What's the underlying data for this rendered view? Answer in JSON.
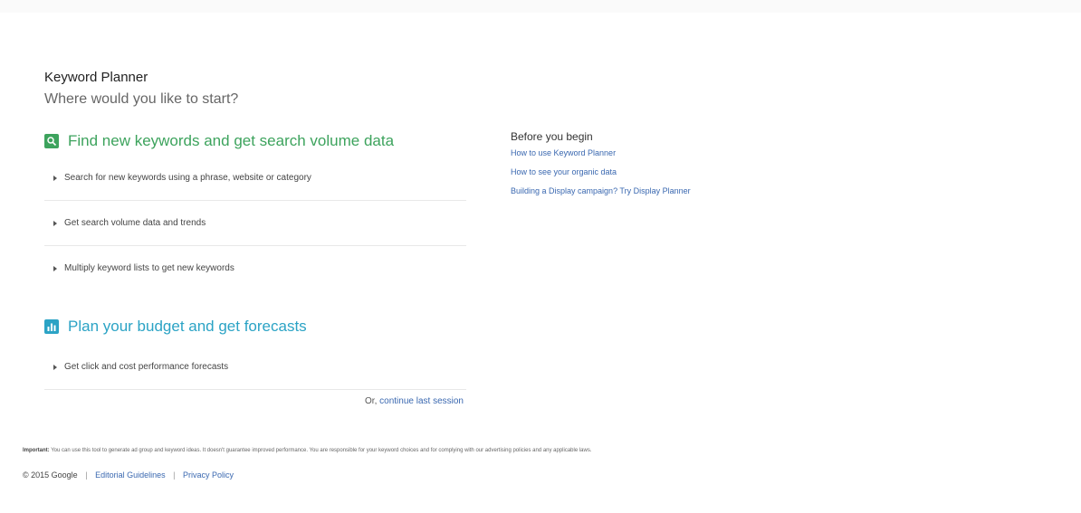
{
  "colors": {
    "section1_accent": "#3da35d",
    "section2_accent": "#2ba3c5",
    "link": "#3a68b0"
  },
  "header": {
    "title": "Keyword Planner",
    "subtitle": "Where would you like to start?"
  },
  "section_find": {
    "icon": "search-icon",
    "title": "Find new keywords and get search volume data",
    "options": [
      "Search for new keywords using a phrase, website or category",
      "Get search volume data and trends",
      "Multiply keyword lists to get new keywords"
    ]
  },
  "section_plan": {
    "icon": "bar-chart-icon",
    "title": "Plan your budget and get forecasts",
    "options": [
      "Get click and cost performance forecasts"
    ]
  },
  "continue": {
    "prefix": "Or,",
    "link": "continue last session"
  },
  "before_you_begin": {
    "heading": "Before you begin",
    "links": [
      "How to use Keyword Planner",
      "How to see your organic data",
      "Building a Display campaign? Try Display Planner"
    ]
  },
  "footer": {
    "important_label": "Important:",
    "important_text": "You can use this tool to generate ad group and keyword ideas. It doesn't guarantee improved performance. You are responsible for your keyword choices and for complying with our advertising policies and any applicable laws.",
    "copyright": "© 2015 Google",
    "sep": "|",
    "links": [
      "Editorial Guidelines",
      "Privacy Policy"
    ]
  }
}
